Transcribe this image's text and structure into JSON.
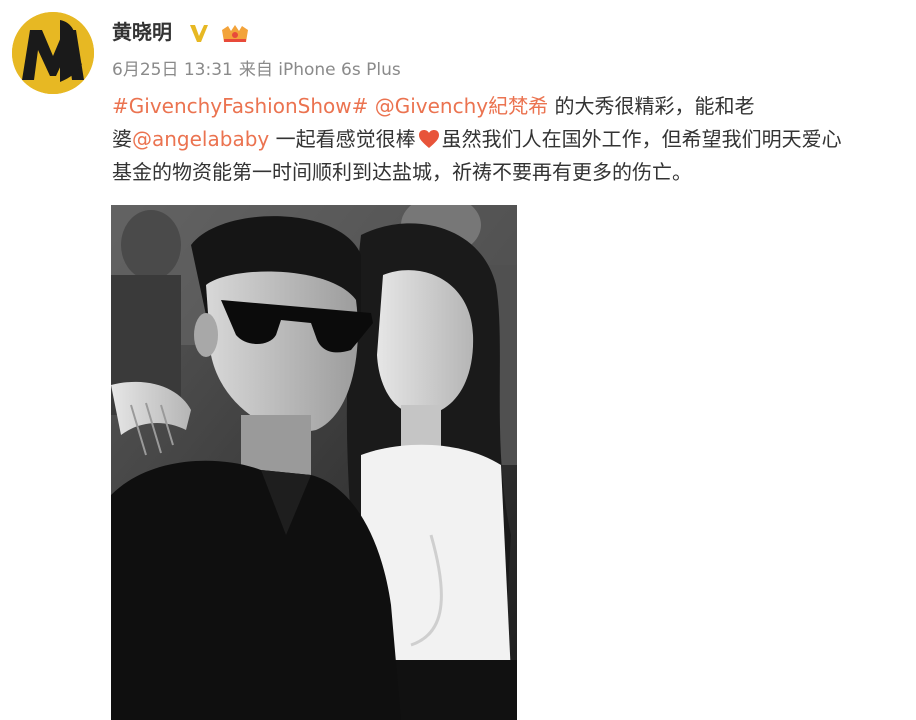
{
  "user": {
    "name": "黄晓明",
    "verified_icon": "verified-v-icon",
    "vip_icon": "vip-crown-icon",
    "accent_color": "#e7b823"
  },
  "meta": {
    "timestamp": "6月25日 13:31",
    "source": "来自 iPhone 6s Plus"
  },
  "post": {
    "hashtag": "#GivenchyFashionShow#",
    "mention1": "@Givenchy紀梵希",
    "text1": " 的大秀很精彩，能和老",
    "text2": "婆",
    "mention2": "@angelababy",
    "text3": " 一起看感觉很棒",
    "heart_icon": "heart-emoji-icon",
    "text4": "虽然我们人在国外工作，但希望我们明天爱心",
    "text5": "基金的物资能第一时间顺利到达盐城，祈祷不要再有更多的伤亡。",
    "link_color": "#eb7350"
  },
  "photo": {
    "style": "black-and-white"
  }
}
